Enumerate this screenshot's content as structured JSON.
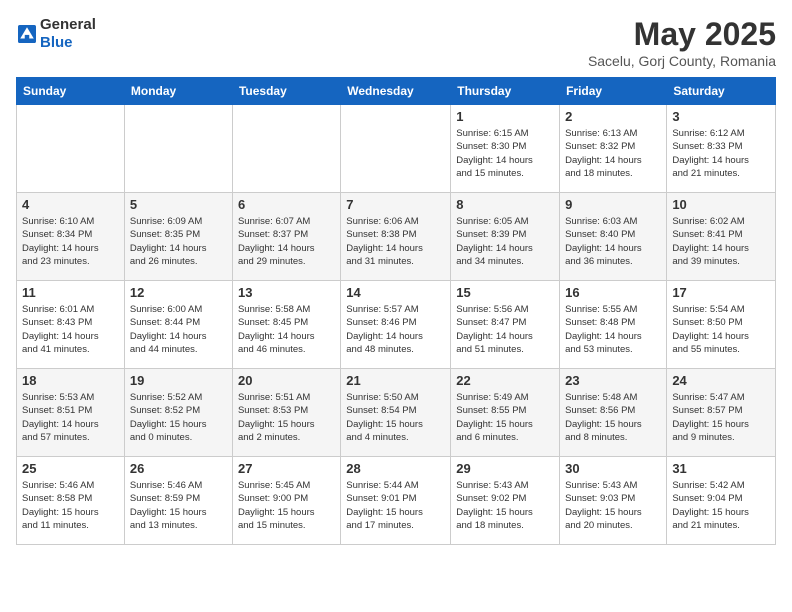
{
  "header": {
    "logo_general": "General",
    "logo_blue": "Blue",
    "month": "May 2025",
    "location": "Sacelu, Gorj County, Romania"
  },
  "weekdays": [
    "Sunday",
    "Monday",
    "Tuesday",
    "Wednesday",
    "Thursday",
    "Friday",
    "Saturday"
  ],
  "weeks": [
    [
      {
        "day": "",
        "info": ""
      },
      {
        "day": "",
        "info": ""
      },
      {
        "day": "",
        "info": ""
      },
      {
        "day": "",
        "info": ""
      },
      {
        "day": "1",
        "info": "Sunrise: 6:15 AM\nSunset: 8:30 PM\nDaylight: 14 hours\nand 15 minutes."
      },
      {
        "day": "2",
        "info": "Sunrise: 6:13 AM\nSunset: 8:32 PM\nDaylight: 14 hours\nand 18 minutes."
      },
      {
        "day": "3",
        "info": "Sunrise: 6:12 AM\nSunset: 8:33 PM\nDaylight: 14 hours\nand 21 minutes."
      }
    ],
    [
      {
        "day": "4",
        "info": "Sunrise: 6:10 AM\nSunset: 8:34 PM\nDaylight: 14 hours\nand 23 minutes."
      },
      {
        "day": "5",
        "info": "Sunrise: 6:09 AM\nSunset: 8:35 PM\nDaylight: 14 hours\nand 26 minutes."
      },
      {
        "day": "6",
        "info": "Sunrise: 6:07 AM\nSunset: 8:37 PM\nDaylight: 14 hours\nand 29 minutes."
      },
      {
        "day": "7",
        "info": "Sunrise: 6:06 AM\nSunset: 8:38 PM\nDaylight: 14 hours\nand 31 minutes."
      },
      {
        "day": "8",
        "info": "Sunrise: 6:05 AM\nSunset: 8:39 PM\nDaylight: 14 hours\nand 34 minutes."
      },
      {
        "day": "9",
        "info": "Sunrise: 6:03 AM\nSunset: 8:40 PM\nDaylight: 14 hours\nand 36 minutes."
      },
      {
        "day": "10",
        "info": "Sunrise: 6:02 AM\nSunset: 8:41 PM\nDaylight: 14 hours\nand 39 minutes."
      }
    ],
    [
      {
        "day": "11",
        "info": "Sunrise: 6:01 AM\nSunset: 8:43 PM\nDaylight: 14 hours\nand 41 minutes."
      },
      {
        "day": "12",
        "info": "Sunrise: 6:00 AM\nSunset: 8:44 PM\nDaylight: 14 hours\nand 44 minutes."
      },
      {
        "day": "13",
        "info": "Sunrise: 5:58 AM\nSunset: 8:45 PM\nDaylight: 14 hours\nand 46 minutes."
      },
      {
        "day": "14",
        "info": "Sunrise: 5:57 AM\nSunset: 8:46 PM\nDaylight: 14 hours\nand 48 minutes."
      },
      {
        "day": "15",
        "info": "Sunrise: 5:56 AM\nSunset: 8:47 PM\nDaylight: 14 hours\nand 51 minutes."
      },
      {
        "day": "16",
        "info": "Sunrise: 5:55 AM\nSunset: 8:48 PM\nDaylight: 14 hours\nand 53 minutes."
      },
      {
        "day": "17",
        "info": "Sunrise: 5:54 AM\nSunset: 8:50 PM\nDaylight: 14 hours\nand 55 minutes."
      }
    ],
    [
      {
        "day": "18",
        "info": "Sunrise: 5:53 AM\nSunset: 8:51 PM\nDaylight: 14 hours\nand 57 minutes."
      },
      {
        "day": "19",
        "info": "Sunrise: 5:52 AM\nSunset: 8:52 PM\nDaylight: 15 hours\nand 0 minutes."
      },
      {
        "day": "20",
        "info": "Sunrise: 5:51 AM\nSunset: 8:53 PM\nDaylight: 15 hours\nand 2 minutes."
      },
      {
        "day": "21",
        "info": "Sunrise: 5:50 AM\nSunset: 8:54 PM\nDaylight: 15 hours\nand 4 minutes."
      },
      {
        "day": "22",
        "info": "Sunrise: 5:49 AM\nSunset: 8:55 PM\nDaylight: 15 hours\nand 6 minutes."
      },
      {
        "day": "23",
        "info": "Sunrise: 5:48 AM\nSunset: 8:56 PM\nDaylight: 15 hours\nand 8 minutes."
      },
      {
        "day": "24",
        "info": "Sunrise: 5:47 AM\nSunset: 8:57 PM\nDaylight: 15 hours\nand 9 minutes."
      }
    ],
    [
      {
        "day": "25",
        "info": "Sunrise: 5:46 AM\nSunset: 8:58 PM\nDaylight: 15 hours\nand 11 minutes."
      },
      {
        "day": "26",
        "info": "Sunrise: 5:46 AM\nSunset: 8:59 PM\nDaylight: 15 hours\nand 13 minutes."
      },
      {
        "day": "27",
        "info": "Sunrise: 5:45 AM\nSunset: 9:00 PM\nDaylight: 15 hours\nand 15 minutes."
      },
      {
        "day": "28",
        "info": "Sunrise: 5:44 AM\nSunset: 9:01 PM\nDaylight: 15 hours\nand 17 minutes."
      },
      {
        "day": "29",
        "info": "Sunrise: 5:43 AM\nSunset: 9:02 PM\nDaylight: 15 hours\nand 18 minutes."
      },
      {
        "day": "30",
        "info": "Sunrise: 5:43 AM\nSunset: 9:03 PM\nDaylight: 15 hours\nand 20 minutes."
      },
      {
        "day": "31",
        "info": "Sunrise: 5:42 AM\nSunset: 9:04 PM\nDaylight: 15 hours\nand 21 minutes."
      }
    ]
  ]
}
